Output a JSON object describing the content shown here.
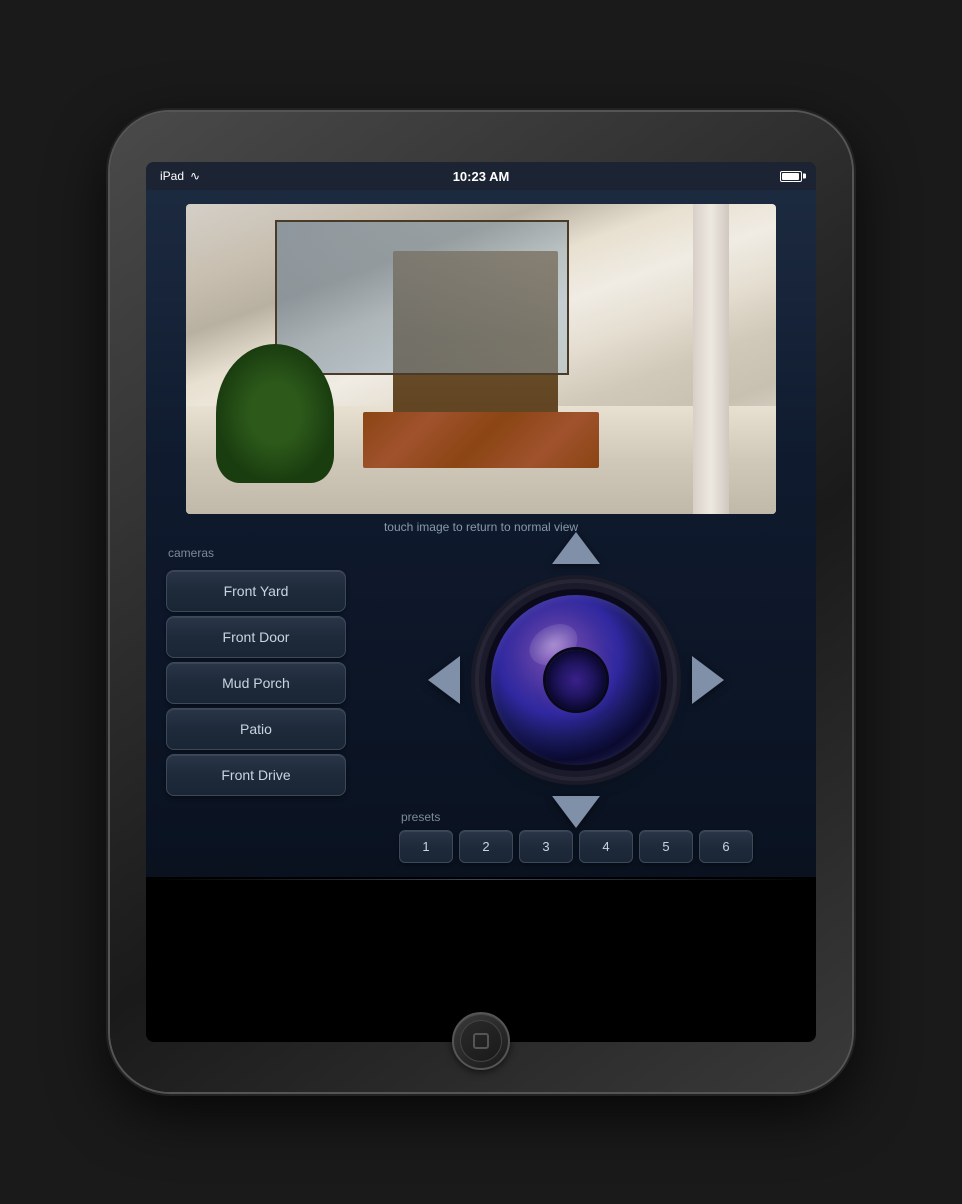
{
  "device": {
    "carrier": "iPad",
    "time": "10:23 AM",
    "battery": "full"
  },
  "status_bar": {
    "carrier": "iPad",
    "wifi_symbol": "⇡",
    "time": "10:23 AM"
  },
  "camera_feed": {
    "hint_text": "touch image to return to normal view"
  },
  "cameras_label": "cameras",
  "camera_buttons": [
    {
      "label": "Front Yard",
      "id": "front-yard"
    },
    {
      "label": "Front Door",
      "id": "front-door"
    },
    {
      "label": "Mud Porch",
      "id": "mud-porch"
    },
    {
      "label": "Patio",
      "id": "patio"
    },
    {
      "label": "Front Drive",
      "id": "front-drive"
    }
  ],
  "ptz": {
    "up_label": "▲",
    "down_label": "▼",
    "left_label": "◄",
    "right_label": "►"
  },
  "presets_label": "presets",
  "preset_buttons": [
    {
      "label": "1"
    },
    {
      "label": "2"
    },
    {
      "label": "3"
    },
    {
      "label": "4"
    },
    {
      "label": "5"
    },
    {
      "label": "6"
    }
  ]
}
